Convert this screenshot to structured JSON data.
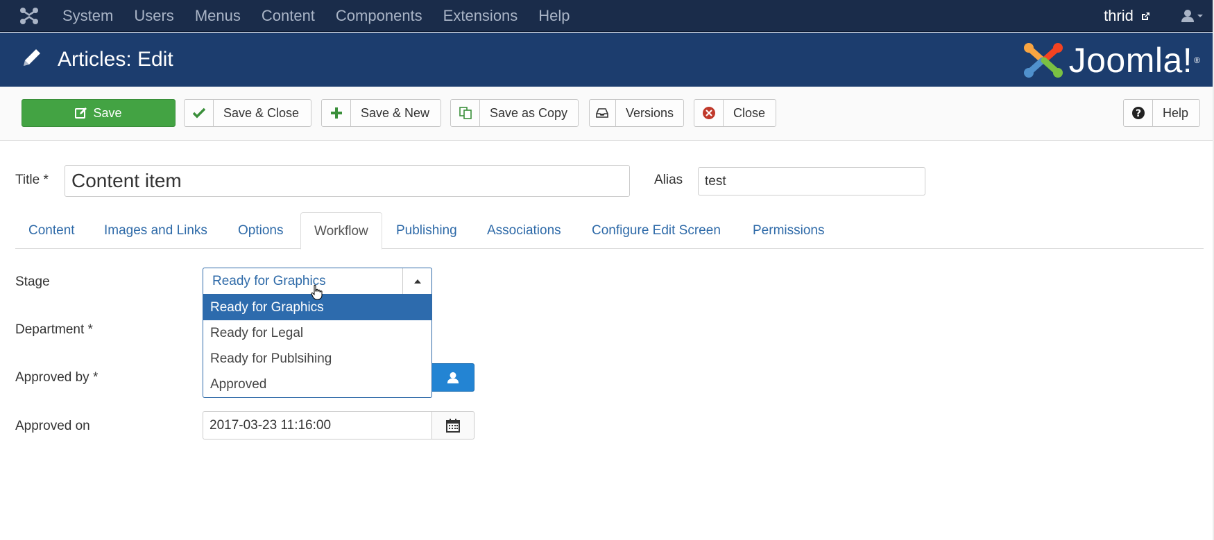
{
  "topnav": {
    "menu": [
      "System",
      "Users",
      "Menus",
      "Content",
      "Components",
      "Extensions",
      "Help"
    ],
    "user_name": "thrid"
  },
  "header": {
    "title": "Articles: Edit",
    "brand": "Joomla!",
    "brand_reg": "®"
  },
  "toolbar": {
    "save": "Save",
    "save_close": "Save & Close",
    "save_new": "Save & New",
    "save_copy": "Save as Copy",
    "versions": "Versions",
    "close": "Close",
    "help": "Help"
  },
  "form": {
    "title_label": "Title *",
    "title_value": "Content item",
    "alias_label": "Alias",
    "alias_value": "test"
  },
  "tabs": [
    "Content",
    "Images and Links",
    "Options",
    "Workflow",
    "Publishing",
    "Associations",
    "Configure Edit Screen",
    "Permissions"
  ],
  "active_tab": "Workflow",
  "workflow": {
    "stage_label": "Stage",
    "stage_value": "Ready for Graphics",
    "stage_options": [
      "Ready for Graphics",
      "Ready for Legal",
      "Ready for Publsihing",
      "Approved"
    ],
    "department_label": "Department *",
    "approved_by_label": "Approved by *",
    "approved_on_label": "Approved on",
    "approved_on_value": "2017-03-23 11:16:00"
  },
  "colors": {
    "topnav_bg": "#1a2c4a",
    "header_bg": "#1c3d6e",
    "save_green": "#43a343",
    "link_blue": "#2e6aa8",
    "selected_option": "#2d6bad",
    "user_button_blue": "#2384d3",
    "close_red": "#c0392b"
  }
}
